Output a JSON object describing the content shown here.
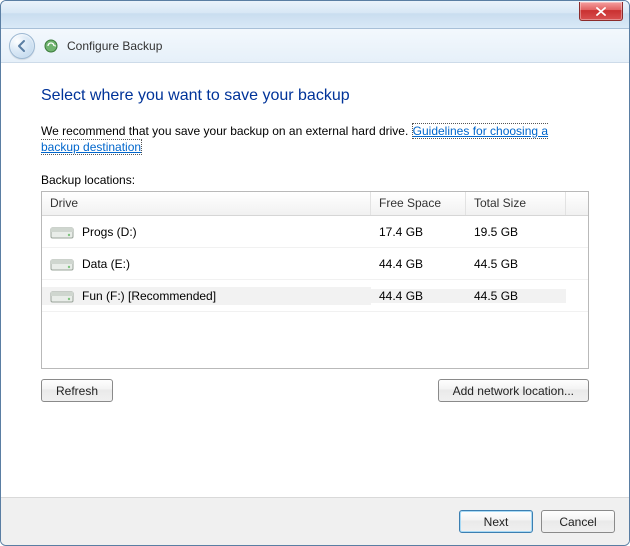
{
  "window": {
    "title": "Configure Backup"
  },
  "page": {
    "heading": "Select where you want to save your backup",
    "recommend_prefix": "We recommend that you save your backup on an external hard drive. ",
    "guidelines_link": "Guidelines for choosing a backup destination",
    "locations_label": "Backup locations:"
  },
  "grid": {
    "columns": {
      "drive": "Drive",
      "free": "Free Space",
      "total": "Total Size"
    },
    "rows": [
      {
        "name": "Progs (D:)",
        "free": "17.4 GB",
        "total": "19.5 GB",
        "selected": false,
        "icon": "hdd"
      },
      {
        "name": "Data (E:)",
        "free": "44.4 GB",
        "total": "44.5 GB",
        "selected": false,
        "icon": "hdd"
      },
      {
        "name": "Fun (F:) [Recommended]",
        "free": "44.4 GB",
        "total": "44.5 GB",
        "selected": true,
        "icon": "hdd"
      }
    ]
  },
  "buttons": {
    "refresh": "Refresh",
    "add_network": "Add network location...",
    "next": "Next",
    "cancel": "Cancel"
  }
}
